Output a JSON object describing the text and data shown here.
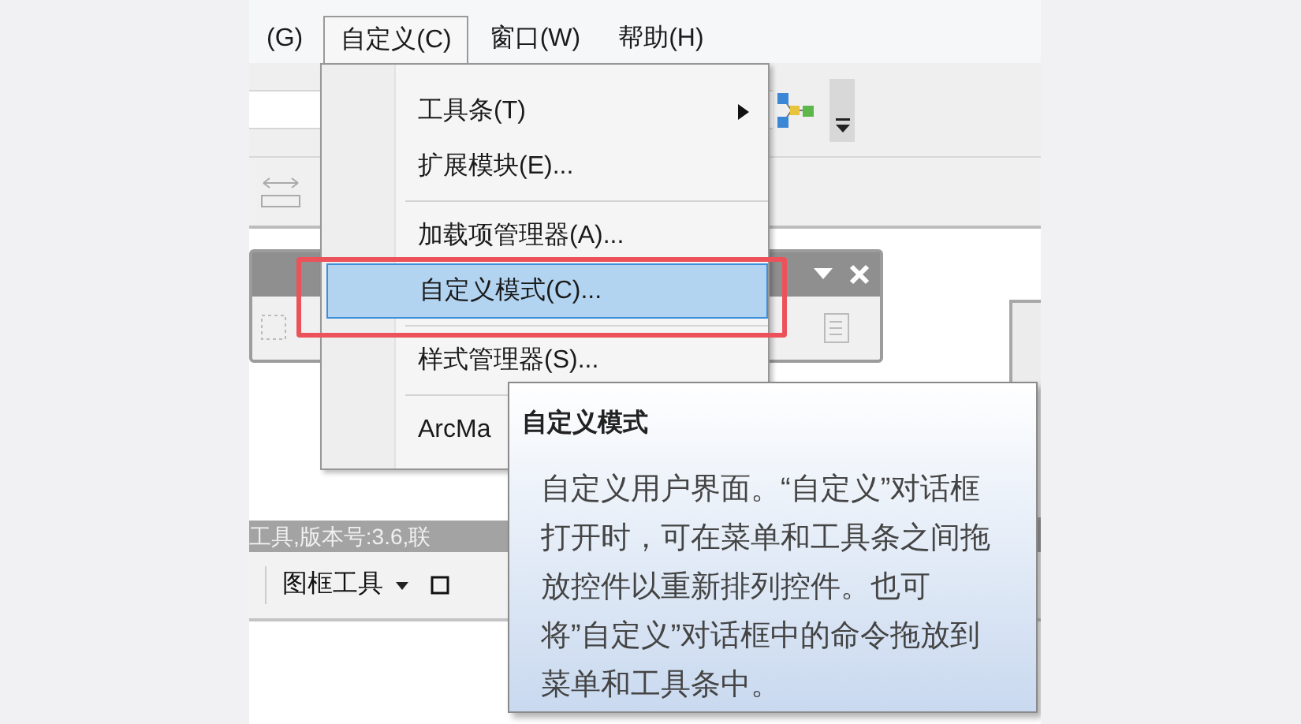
{
  "menubar": {
    "items": [
      {
        "label": "(G)",
        "selected": false
      },
      {
        "label": "自定义(C)",
        "selected": true
      },
      {
        "label": "窗口(W)",
        "selected": false
      },
      {
        "label": "帮助(H)",
        "selected": false
      }
    ]
  },
  "menu": {
    "items": [
      {
        "kind": "command",
        "label": "工具条(T)",
        "submenu": true,
        "highlighted": false
      },
      {
        "kind": "command",
        "label": "扩展模块(E)...",
        "submenu": false,
        "highlighted": false
      },
      {
        "kind": "separator"
      },
      {
        "kind": "command",
        "label": "加载项管理器(A)...",
        "submenu": false,
        "highlighted": false
      },
      {
        "kind": "command",
        "label": "自定义模式(C)...",
        "submenu": false,
        "highlighted": true
      },
      {
        "kind": "separator"
      },
      {
        "kind": "command",
        "label": "样式管理器(S)...",
        "submenu": false,
        "highlighted": false
      },
      {
        "kind": "separator"
      },
      {
        "kind": "command",
        "label": "ArcMa",
        "submenu": false,
        "highlighted": false
      }
    ]
  },
  "status_text": "工具,版本号:3.6,联",
  "frame_toolbar": {
    "label": "图框工具"
  },
  "tooltip": {
    "title": "自定义模式",
    "body": "自定义用户界面。“自定义”对话框打开时，可在菜单和工具条之间拖放控件以重新排列控件。也可将”自定义”对话框中的命令拖放到菜单和工具条中。"
  }
}
